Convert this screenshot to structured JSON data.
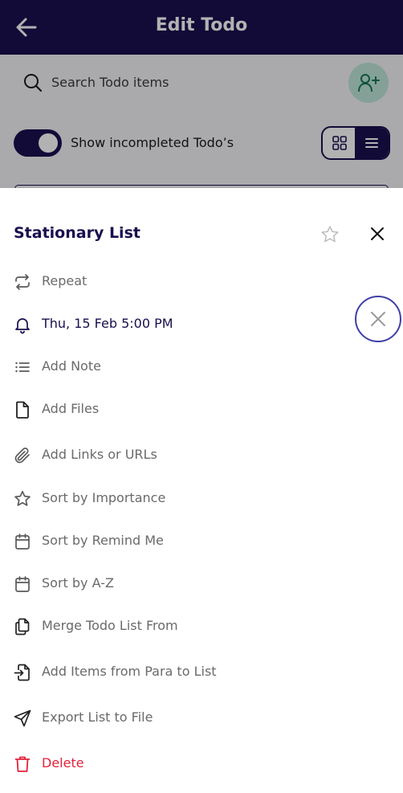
{
  "header": {
    "title": "Edit Todo",
    "back_icon": "arrow-left-icon"
  },
  "search": {
    "placeholder": "Search Todo items"
  },
  "toggle": {
    "label": "Show incompleted Todo’s",
    "on": true
  },
  "view_switch": {
    "options": [
      "grid",
      "list"
    ],
    "selected": "list"
  },
  "sheet": {
    "title": "Stationary List",
    "items": [
      {
        "label": "Repeat",
        "icon": "repeat-icon"
      },
      {
        "label": "Thu, 15 Feb 5:00 PM",
        "icon": "bell-icon"
      },
      {
        "label": "Add Note",
        "icon": "list-icon"
      },
      {
        "label": "Add Files",
        "icon": "file-icon"
      },
      {
        "label": "Add Links or URLs",
        "icon": "paperclip-icon"
      },
      {
        "label": "Sort by Importance",
        "icon": "star-icon"
      },
      {
        "label": "Sort by Remind Me",
        "icon": "calendar-icon"
      },
      {
        "label": "Sort by A-Z",
        "icon": "calendar-icon"
      },
      {
        "label": "Merge Todo List From",
        "icon": "copy-icon"
      },
      {
        "label": "Add Items from Para to List",
        "icon": "file-import-icon"
      },
      {
        "label": "Export List to File",
        "icon": "send-icon"
      },
      {
        "label": "Delete",
        "icon": "trash-icon"
      }
    ]
  },
  "colors": {
    "primary": "#1a0f4f",
    "accent_green": "#bfe6d8",
    "danger": "#e5213a",
    "muted_text": "#6a6a6a",
    "focus_ring": "#3f3fa8"
  }
}
